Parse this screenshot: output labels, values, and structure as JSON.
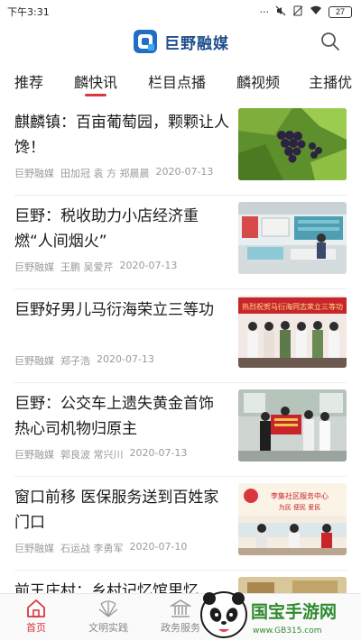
{
  "status_bar": {
    "time": "下午3:31",
    "battery": "27"
  },
  "header": {
    "app_name": "巨野融媒"
  },
  "tabs": [
    {
      "label": "推荐",
      "active": false
    },
    {
      "label": "麟快讯",
      "active": true
    },
    {
      "label": "栏目点播",
      "active": false
    },
    {
      "label": "麟视频",
      "active": false
    },
    {
      "label": "主播优",
      "active": false
    }
  ],
  "news": [
    {
      "title": "麒麟镇：百亩葡萄园，颗颗让人馋！",
      "meta": [
        "巨野融媒",
        "田加冠 袁 方 郑晨晨",
        "2020-07-13"
      ]
    },
    {
      "title": "巨野：税收助力小店经济重燃“人间烟火”",
      "meta": [
        "巨野融媒",
        "王鹏 吴爱芹",
        "2020-07-13"
      ]
    },
    {
      "title": "巨野好男儿马衍海荣立三等功",
      "meta": [
        "巨野融媒",
        "郑子浩",
        "2020-07-13"
      ]
    },
    {
      "title": "巨野：公交车上遗失黄金首饰 热心司机物归原主",
      "meta": [
        "巨野融媒",
        "郭良波 常兴川",
        "2020-07-13"
      ]
    },
    {
      "title": "窗口前移 医保服务送到百姓家门口",
      "meta": [
        "巨野融媒",
        "石运战 李勇军",
        "2020-07-10"
      ]
    },
    {
      "title": "前王庄村：乡村记忆馆里忆",
      "meta": []
    }
  ],
  "thumb_text": {
    "banner3": "热烈祝贺马衍海同志荣立三等功",
    "banner5": "李集社区服务中心",
    "banner5_sub": "为民 便民 爱民"
  },
  "tabbar": [
    {
      "label": "首页",
      "icon": "home-icon",
      "active": true
    },
    {
      "label": "文明实践",
      "icon": "civilization-icon",
      "active": false
    },
    {
      "label": "政务服务",
      "icon": "government-icon",
      "active": false
    }
  ],
  "watermark": {
    "brand": "国宝手游网",
    "url": "www.GB315.com"
  },
  "colors": {
    "accent": "#d9363e",
    "brand": "#1f4e8c",
    "meta": "#9a9a9a"
  }
}
